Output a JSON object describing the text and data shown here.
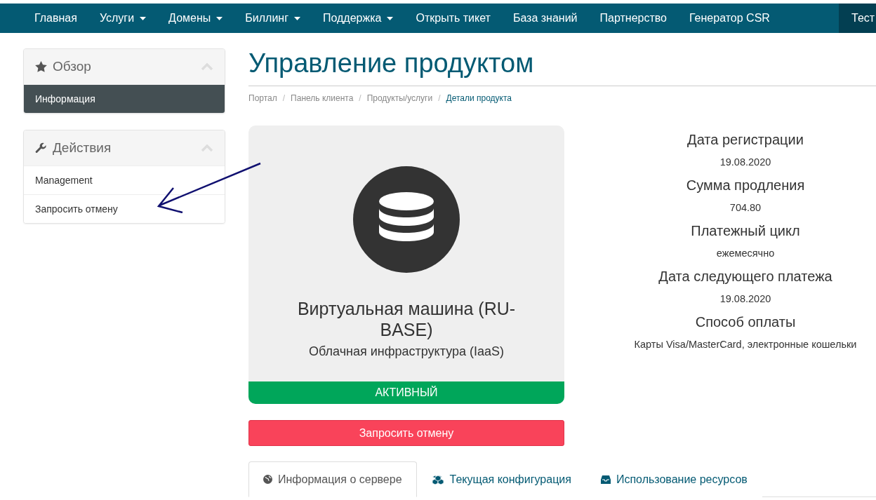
{
  "nav": {
    "items": [
      {
        "label": "Главная",
        "dropdown": false
      },
      {
        "label": "Услуги",
        "dropdown": true
      },
      {
        "label": "Домены",
        "dropdown": true
      },
      {
        "label": "Биллинг",
        "dropdown": true
      },
      {
        "label": "Поддержка",
        "dropdown": true
      },
      {
        "label": "Открыть тикет",
        "dropdown": false
      },
      {
        "label": "База знаний",
        "dropdown": false
      },
      {
        "label": "Партнерство",
        "dropdown": false
      },
      {
        "label": "Генератор CSR",
        "dropdown": false
      }
    ],
    "account": {
      "label": "Тест"
    }
  },
  "sidebar": {
    "panels": [
      {
        "title": "Обзор",
        "expanded": true,
        "items": [
          {
            "label": "Информация",
            "selected": true
          }
        ]
      },
      {
        "title": "Действия",
        "expanded": true,
        "items": [
          {
            "label": "Management",
            "selected": false
          },
          {
            "label": "Запросить отмену",
            "selected": false
          }
        ]
      }
    ]
  },
  "page": {
    "title": "Управление продуктом",
    "breadcrumb_separator": "/",
    "breadcrumb": [
      {
        "label": "Портал",
        "current": false
      },
      {
        "label": "Панель клиента",
        "current": false
      },
      {
        "label": "Продукты/услуги",
        "current": false
      },
      {
        "label": "Детали продукта",
        "current": true
      }
    ]
  },
  "product": {
    "name": "Виртуальная машина (RU-BASE)",
    "group": "Облачная инфраструктура (IaaS)",
    "status": "АКТИВНЫЙ",
    "active": true
  },
  "cancel_button": "Запросить отмену",
  "details": [
    {
      "label": "Дата регистрации",
      "value": "19.08.2020"
    },
    {
      "label": "Сумма продления",
      "value": "704.80"
    },
    {
      "label": "Платежный цикл",
      "value": "ежемесячно"
    },
    {
      "label": "Дата следующего платежа",
      "value": "19.08.2020"
    },
    {
      "label": "Способ оплаты",
      "value": "Карты Visa/MasterCard, электронные кошельки"
    }
  ],
  "tabs": [
    {
      "label": "Информация о сервере",
      "selected": true
    },
    {
      "label": "Текущая конфигурация",
      "selected": false
    },
    {
      "label": "Использование ресурсов",
      "selected": false
    }
  ]
}
